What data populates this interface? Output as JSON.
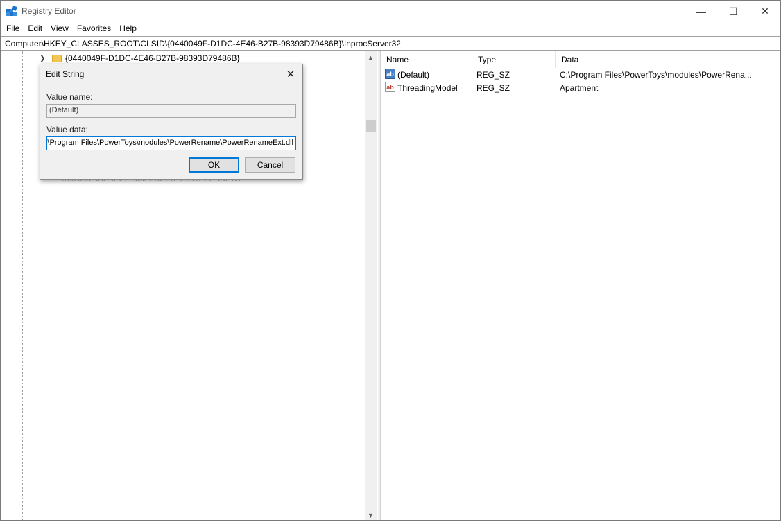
{
  "window": {
    "title": "Registry Editor",
    "controls": {
      "minimize": "—",
      "maximize": "☐",
      "close": "✕"
    }
  },
  "menu": [
    "File",
    "Edit",
    "View",
    "Favorites",
    "Help"
  ],
  "address": "Computer\\HKEY_CLASSES_ROOT\\CLSID\\{0440049F-D1DC-4E46-B27B-98393D79486B}\\InprocServer32",
  "tree": {
    "selected_key": "{0440049F-D1DC-4E46-B27B-98393D79486B}",
    "partially_hidden_key": "{04D55CAA-2EEE-4553-BEFB-19D7BFC2BCB1}"
  },
  "list": {
    "columns": [
      "Name",
      "Type",
      "Data"
    ],
    "rows": [
      {
        "name": "(Default)",
        "type": "REG_SZ",
        "data": "C:\\Program Files\\PowerToys\\modules\\PowerRena..."
      },
      {
        "name": "ThreadingModel",
        "type": "REG_SZ",
        "data": "Apartment"
      }
    ]
  },
  "dialog": {
    "title": "Edit String",
    "value_name_label": "Value name:",
    "value_name": "(Default)",
    "value_data_label": "Value data:",
    "value_data": "C:\\Program Files\\PowerToys\\modules\\PowerRename\\PowerRenameExt.dll",
    "ok_label": "OK",
    "cancel_label": "Cancel"
  },
  "colors": {
    "accent": "#0078d7",
    "folder": "#f4c752"
  }
}
